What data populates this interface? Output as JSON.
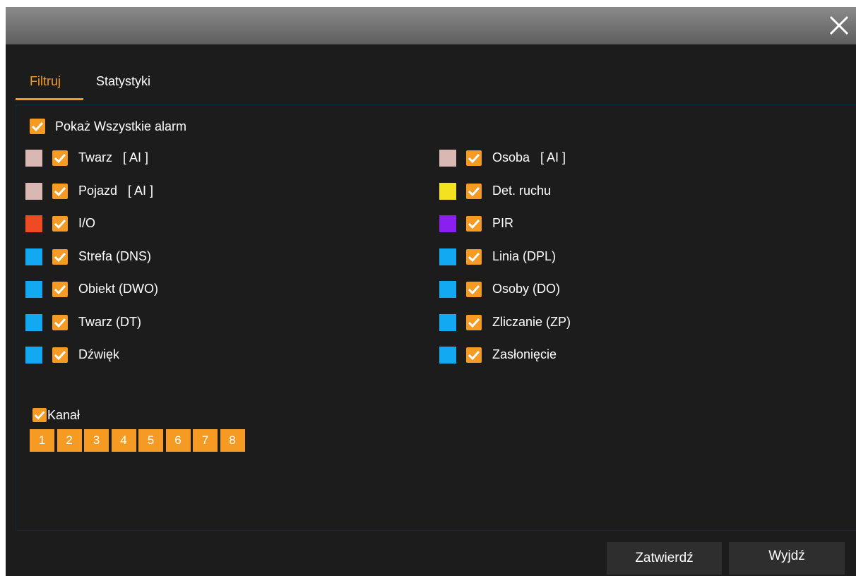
{
  "tabs": {
    "filter": "Filtruj",
    "statistics": "Statystyki"
  },
  "show_all": {
    "label": "Pokaż Wszystkie alarm",
    "checked": true
  },
  "alarms_left": [
    {
      "label": "Twarz   [ AI ]",
      "color": "#d9b8b4",
      "checked": true
    },
    {
      "label": "Pojazd   [ AI ]",
      "color": "#d9b8b4",
      "checked": true
    },
    {
      "label": "I/O",
      "color": "#f04a24",
      "checked": true
    },
    {
      "label": "Strefa (DNS)",
      "color": "#13a9f2",
      "checked": true
    },
    {
      "label": "Obiekt (DWO)",
      "color": "#13a9f2",
      "checked": true
    },
    {
      "label": "Twarz (DT)",
      "color": "#13a9f2",
      "checked": true
    },
    {
      "label": "Dźwięk",
      "color": "#13a9f2",
      "checked": true
    }
  ],
  "alarms_right": [
    {
      "label": "Osoba   [ AI ]",
      "color": "#d9b8b4",
      "checked": true
    },
    {
      "label": "Det. ruchu",
      "color": "#f2e21f",
      "checked": true
    },
    {
      "label": "PIR",
      "color": "#8b1ff2",
      "checked": true
    },
    {
      "label": "Linia (DPL)",
      "color": "#13a9f2",
      "checked": true
    },
    {
      "label": "Osoby (DO)",
      "color": "#13a9f2",
      "checked": true
    },
    {
      "label": "Zliczanie (ZP)",
      "color": "#13a9f2",
      "checked": true
    },
    {
      "label": "Zasłonięcie",
      "color": "#13a9f2",
      "checked": true
    }
  ],
  "channel": {
    "label": "Kanał",
    "checked": true,
    "numbers": [
      "1",
      "2",
      "3",
      "4",
      "5",
      "6",
      "7",
      "8"
    ]
  },
  "buttons": {
    "confirm": "Zatwierdź",
    "exit": "Wyjdź"
  },
  "colors": {
    "accent": "#f59a23",
    "background": "#1c1c1c",
    "button": "#2e2e2e"
  },
  "icons": {
    "close": "close-icon",
    "check": "checkmark-icon"
  }
}
